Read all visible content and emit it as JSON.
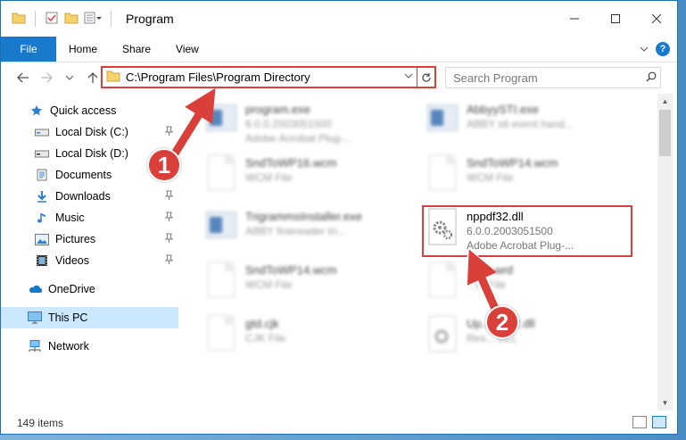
{
  "window": {
    "title": "Program"
  },
  "ribbon": {
    "tabs": [
      "File",
      "Home",
      "Share",
      "View"
    ],
    "help": "?"
  },
  "nav": {
    "address": "C:\\Program Files\\Program Directory",
    "search_placeholder": "Search Program"
  },
  "sidebar": {
    "items": [
      {
        "label": "Quick access",
        "icon": "star-icon",
        "pinned": false
      },
      {
        "label": "Local Disk (C:)",
        "icon": "drive-icon",
        "pinned": true
      },
      {
        "label": "Local Disk (D:)",
        "icon": "drive-icon",
        "pinned": false
      },
      {
        "label": "Documents",
        "icon": "documents-icon",
        "pinned": true
      },
      {
        "label": "Downloads",
        "icon": "downloads-icon",
        "pinned": true
      },
      {
        "label": "Music",
        "icon": "music-icon",
        "pinned": true
      },
      {
        "label": "Pictures",
        "icon": "pictures-icon",
        "pinned": true
      },
      {
        "label": "Videos",
        "icon": "videos-icon",
        "pinned": true
      },
      {
        "label": "OneDrive",
        "icon": "onedrive-icon",
        "pinned": false
      },
      {
        "label": "This PC",
        "icon": "this-pc-icon",
        "pinned": false
      },
      {
        "label": "Network",
        "icon": "network-icon",
        "pinned": false
      }
    ]
  },
  "files": [
    {
      "name": "program.exe",
      "line1": "6.0.0.2003051500",
      "line2": "Adobe Acrobat Plug-...",
      "icon": "exe-icon"
    },
    {
      "name": "AbbyySTI.exe",
      "line1": "ABBY sti event hand...",
      "line2": "",
      "icon": "exe-icon"
    },
    {
      "name": "SndToWP16.wcm",
      "line1": "WCM File",
      "line2": "",
      "icon": "document-icon"
    },
    {
      "name": "SndToWP14.wcm",
      "line1": "WCM File",
      "line2": "",
      "icon": "document-icon"
    },
    {
      "name": "TrigrammsInstaller.exe",
      "line1": "ABBY finereader tri...",
      "line2": "",
      "icon": "exe-icon"
    },
    {
      "name": "nppdf32.dll",
      "line1": "6.0.0.2003051500",
      "line2": "Adobe Acrobat Plug-...",
      "icon": "dll-gear-icon"
    },
    {
      "name": "SndToWP14.wcm",
      "line1": "WCM File",
      "line2": "",
      "icon": "document-icon"
    },
    {
      "name": "...bic.wrd",
      "line1": "...W File",
      "line2": "",
      "icon": "document-icon"
    },
    {
      "name": "gtd.cjk",
      "line1": "CJK File",
      "line2": "",
      "icon": "document-icon"
    },
    {
      "name": "Up...ent42.dll",
      "line1": "Res... DLL",
      "line2": "",
      "icon": "dll-gear-icon"
    }
  ],
  "status": {
    "items_count": "149 items"
  },
  "annotations": {
    "step1": "1",
    "step2": "2"
  },
  "colors": {
    "accent": "#1979ca",
    "highlight": "#d9403a",
    "selected": "#cce8ff"
  }
}
